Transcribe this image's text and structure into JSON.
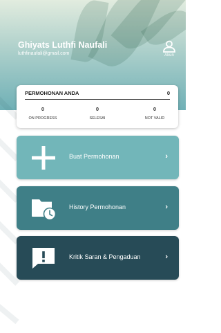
{
  "profile": {
    "name": "Ghiyats Luthfi Naufali",
    "email": "luthfinaufali@gmail.com",
    "account_label": "Akun",
    "account_icon": "user-icon"
  },
  "summary": {
    "title": "PERMOHONAN ANDA",
    "total": "0",
    "stats": [
      {
        "value": "0",
        "label": "ON PROGRESS"
      },
      {
        "value": "0",
        "label": "SELESAI"
      },
      {
        "value": "0",
        "label": "NOT VALID"
      }
    ]
  },
  "menu": [
    {
      "label": "Buat Permohonan",
      "icon": "plus-icon",
      "color": "#72b6b9"
    },
    {
      "label": "History Permohonan",
      "icon": "folder-clock-icon",
      "color": "#3f7f87"
    },
    {
      "label": "Kritik Saran & Pengaduan",
      "icon": "feedback-icon",
      "color": "#274b57"
    }
  ],
  "chevron": "›",
  "colors": {
    "header_top": "#e2ecdf",
    "header_bottom": "#6fb0b6",
    "text_dark": "#222222"
  }
}
